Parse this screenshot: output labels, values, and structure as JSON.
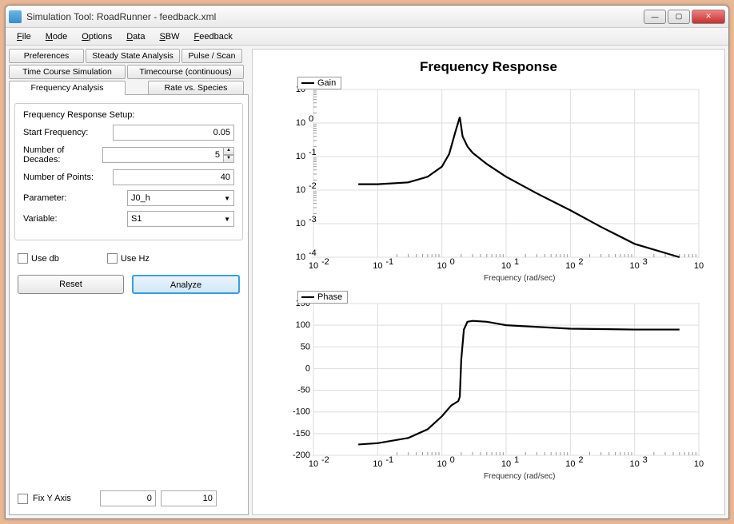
{
  "window": {
    "title": "Simulation Tool: RoadRunner - feedback.xml"
  },
  "menu": {
    "file": "File",
    "mode": "Mode",
    "options": "Options",
    "data": "Data",
    "sbw": "SBW",
    "feedback": "Feedback"
  },
  "tabs_row1": {
    "preferences": "Preferences",
    "steady": "Steady State Analysis",
    "pulse": "Pulse / Scan"
  },
  "tabs_row2": {
    "timecourse": "Time Course Simulation",
    "tcont": "Timecourse (continuous)"
  },
  "tabs_row3": {
    "freq": "Frequency Analysis",
    "rate": "Rate vs. Species"
  },
  "setup": {
    "legend": "Frequency Response Setup:",
    "start_freq_label": "Start Frequency:",
    "start_freq": "0.05",
    "decades_label": "Number of Decades:",
    "decades": "5",
    "points_label": "Number of Points:",
    "points": "40",
    "param_label": "Parameter:",
    "param": "J0_h",
    "var_label": "Variable:",
    "var": "S1"
  },
  "checks": {
    "use_db": "Use db",
    "use_hz": "Use Hz"
  },
  "buttons": {
    "reset": "Reset",
    "analyze": "Analyze"
  },
  "fixy": {
    "label": "Fix Y Axis",
    "min": "0",
    "max": "10"
  },
  "chart": {
    "title": "Frequency Response",
    "gain_legend": "Gain",
    "phase_legend": "Phase",
    "xlabel": "Frequency (rad/sec)"
  },
  "chart_data": [
    {
      "type": "line",
      "title": "Gain",
      "xscale": "log",
      "yscale": "log",
      "xlabel": "Frequency (rad/sec)",
      "ylabel": "",
      "xlim": [
        0.01,
        10000
      ],
      "ylim": [
        0.0001,
        10
      ],
      "xticks": [
        0.01,
        0.1,
        1,
        10,
        100,
        1000,
        10000
      ],
      "yticks": [
        0.0001,
        0.001,
        0.01,
        0.1,
        1,
        10
      ],
      "series": [
        {
          "name": "Gain",
          "x": [
            0.05,
            0.1,
            0.3,
            0.6,
            1,
            1.3,
            1.6,
            1.9,
            2.1,
            2.5,
            3,
            5,
            10,
            30,
            100,
            300,
            1000,
            5000
          ],
          "y": [
            0.015,
            0.015,
            0.017,
            0.025,
            0.05,
            0.12,
            0.5,
            1.5,
            0.4,
            0.2,
            0.13,
            0.06,
            0.025,
            0.008,
            0.0025,
            0.0008,
            0.00025,
            0.0001
          ]
        }
      ]
    },
    {
      "type": "line",
      "title": "Phase",
      "xscale": "log",
      "yscale": "linear",
      "xlabel": "Frequency (rad/sec)",
      "ylabel": "",
      "xlim": [
        0.01,
        10000
      ],
      "ylim": [
        -200,
        150
      ],
      "xticks": [
        0.01,
        0.1,
        1,
        10,
        100,
        1000,
        10000
      ],
      "yticks": [
        -200,
        -150,
        -100,
        -50,
        0,
        50,
        100,
        150
      ],
      "series": [
        {
          "name": "Phase",
          "x": [
            0.05,
            0.1,
            0.3,
            0.6,
            1,
            1.4,
            1.8,
            1.9,
            2.0,
            2.2,
            2.5,
            3,
            5,
            10,
            100,
            1000,
            5000
          ],
          "y": [
            -175,
            -172,
            -160,
            -140,
            -110,
            -85,
            -75,
            -65,
            20,
            90,
            108,
            110,
            108,
            100,
            92,
            90,
            90
          ]
        }
      ]
    }
  ]
}
